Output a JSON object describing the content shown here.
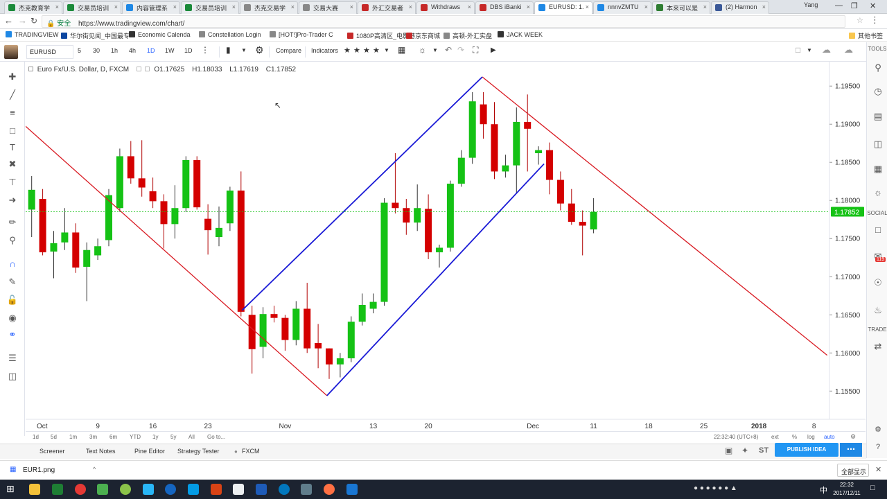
{
  "browser": {
    "tabs": [
      {
        "label": "杰克教育学",
        "color": "#1b8a3a",
        "active": false
      },
      {
        "label": "交易员培训",
        "color": "#1b8a3a",
        "active": false
      },
      {
        "label": "内容管理系",
        "color": "#1e88e5",
        "active": false
      },
      {
        "label": "交易员培训",
        "color": "#1b8a3a",
        "active": false
      },
      {
        "label": "杰克交易学",
        "color": "#888888",
        "active": false
      },
      {
        "label": "交易大赛",
        "color": "#888888",
        "active": false
      },
      {
        "label": "外汇交易者",
        "color": "#c62828",
        "active": false
      },
      {
        "label": "Withdraws",
        "color": "#c62828",
        "active": false
      },
      {
        "label": "DBS iBanki",
        "color": "#c62828",
        "active": false
      },
      {
        "label": "EURUSD: 1.",
        "color": "#1e88e5",
        "active": true
      },
      {
        "label": "nnnvZMTU",
        "color": "#1e88e5",
        "active": false
      },
      {
        "label": "本来可以是",
        "color": "#2e7d32",
        "active": false
      },
      {
        "label": "(2) Harmon",
        "color": "#3b5998",
        "active": false
      }
    ],
    "user": "Yang",
    "secure_label": "安全",
    "url": "https://www.tradingview.com/chart/",
    "bookmarks": [
      {
        "label": "TRADINGVIEW",
        "color": "#1e88e5"
      },
      {
        "label": "华尔街见闻_中国最专",
        "color": "#0d47a1"
      },
      {
        "label": "Economic Calenda",
        "color": "#333333"
      },
      {
        "label": "Constellation Login",
        "color": "#888888"
      },
      {
        "label": "[HOT!]Pro-Trader C",
        "color": "#888888"
      },
      {
        "label": "1080P高清区_电影港",
        "color": "#c62828"
      },
      {
        "label": "京东商城",
        "color": "#c62828"
      },
      {
        "label": "高顿-外汇实盘",
        "color": "#888888"
      },
      {
        "label": "JACK WEEK",
        "color": "#333333"
      }
    ],
    "other_bookmarks": "其他书签"
  },
  "toolbar": {
    "symbol": "EURUSD",
    "intervals": [
      "5",
      "30",
      "1h",
      "4h",
      "1D",
      "1W",
      "1D"
    ],
    "compare": "Compare",
    "indicators": "Indicators"
  },
  "legend": {
    "title": "Euro Fx/U.S. Dollar, D, FXCM",
    "open": "O1.17625",
    "high": "H1.18033",
    "low": "L1.17619",
    "close": "C1.17852"
  },
  "right_panel": {
    "tools_label": "TOOLS",
    "social_label": "SOCIAL",
    "trade_label": "TRADE",
    "badge": "119"
  },
  "range_bar": {
    "ranges": [
      "1d",
      "5d",
      "1m",
      "3m",
      "6m",
      "YTD",
      "1y",
      "5y",
      "All",
      "Go to..."
    ],
    "time": "22:32:40 (UTC+8)",
    "options": [
      "ext",
      "%",
      "log",
      "auto"
    ]
  },
  "bottom_panel": {
    "tabs": [
      "Screener",
      "Text Notes",
      "Pine Editor",
      "Strategy Tester",
      "FXCM"
    ],
    "publish": "PUBLISH IDEA"
  },
  "downloads": {
    "file": "EUR1.png",
    "show_all": "全部显示"
  },
  "taskbar": {
    "lang": "中",
    "time": "22:32",
    "date": "2017/12/11"
  },
  "chart_data": {
    "type": "candlestick",
    "price_scale": {
      "ticks": [
        "1.19500",
        "1.19000",
        "1.18500",
        "1.18000",
        "1.17500",
        "1.17000",
        "1.16500",
        "1.16000",
        "1.15500"
      ],
      "current": "1.17852",
      "ylim": [
        1.1513,
        1.1982
      ]
    },
    "time_ticks": [
      "Oct",
      "9",
      "16",
      "23",
      "Nov",
      "13",
      "20",
      "Dec",
      "11",
      "18",
      "25",
      "2018",
      "8"
    ],
    "colors": {
      "up": "#15c215",
      "down": "#d40000",
      "down_wick": "#b00000",
      "up_wick": "#333333",
      "trend_red": "#d91c24",
      "trend_blue": "#1a1ad6"
    },
    "candles": [
      {
        "o": 1.1788,
        "h": 1.1832,
        "l": 1.1752,
        "c": 1.1814
      },
      {
        "o": 1.1802,
        "h": 1.1815,
        "l": 1.1728,
        "c": 1.1732
      },
      {
        "o": 1.1733,
        "h": 1.176,
        "l": 1.1698,
        "c": 1.1744
      },
      {
        "o": 1.1745,
        "h": 1.179,
        "l": 1.1735,
        "c": 1.1758
      },
      {
        "o": 1.1758,
        "h": 1.177,
        "l": 1.1705,
        "c": 1.1712
      },
      {
        "o": 1.1713,
        "h": 1.1745,
        "l": 1.1668,
        "c": 1.1735
      },
      {
        "o": 1.1728,
        "h": 1.175,
        "l": 1.1722,
        "c": 1.174
      },
      {
        "o": 1.1748,
        "h": 1.1815,
        "l": 1.174,
        "c": 1.1807
      },
      {
        "o": 1.179,
        "h": 1.1868,
        "l": 1.1785,
        "c": 1.1858
      },
      {
        "o": 1.1858,
        "h": 1.1878,
        "l": 1.1822,
        "c": 1.1829
      },
      {
        "o": 1.1829,
        "h": 1.1879,
        "l": 1.1805,
        "c": 1.1817
      },
      {
        "o": 1.1812,
        "h": 1.183,
        "l": 1.179,
        "c": 1.1799
      },
      {
        "o": 1.1799,
        "h": 1.1808,
        "l": 1.1737,
        "c": 1.1769
      },
      {
        "o": 1.1769,
        "h": 1.182,
        "l": 1.175,
        "c": 1.179
      },
      {
        "o": 1.179,
        "h": 1.1858,
        "l": 1.1785,
        "c": 1.1853
      },
      {
        "o": 1.1853,
        "h": 1.1858,
        "l": 1.1788,
        "c": 1.1791
      },
      {
        "o": 1.1776,
        "h": 1.1795,
        "l": 1.1729,
        "c": 1.1761
      },
      {
        "o": 1.1752,
        "h": 1.1792,
        "l": 1.174,
        "c": 1.1764
      },
      {
        "o": 1.177,
        "h": 1.1818,
        "l": 1.176,
        "c": 1.1813
      },
      {
        "o": 1.1813,
        "h": 1.1838,
        "l": 1.1648,
        "c": 1.1654
      },
      {
        "o": 1.165,
        "h": 1.1662,
        "l": 1.1573,
        "c": 1.1605
      },
      {
        "o": 1.1608,
        "h": 1.166,
        "l": 1.1593,
        "c": 1.1651
      },
      {
        "o": 1.1651,
        "h": 1.1662,
        "l": 1.164,
        "c": 1.1646
      },
      {
        "o": 1.1646,
        "h": 1.165,
        "l": 1.1603,
        "c": 1.1617
      },
      {
        "o": 1.1617,
        "h": 1.1668,
        "l": 1.161,
        "c": 1.1658
      },
      {
        "o": 1.1658,
        "h": 1.1692,
        "l": 1.16,
        "c": 1.1606
      },
      {
        "o": 1.1613,
        "h": 1.1638,
        "l": 1.158,
        "c": 1.1606
      },
      {
        "o": 1.1606,
        "h": 1.1592,
        "l": 1.1566,
        "c": 1.1585
      },
      {
        "o": 1.1585,
        "h": 1.16,
        "l": 1.1568,
        "c": 1.1593
      },
      {
        "o": 1.1593,
        "h": 1.1648,
        "l": 1.1588,
        "c": 1.1641
      },
      {
        "o": 1.1641,
        "h": 1.1678,
        "l": 1.1636,
        "c": 1.1663
      },
      {
        "o": 1.1658,
        "h": 1.1678,
        "l": 1.1652,
        "c": 1.1667
      },
      {
        "o": 1.1667,
        "h": 1.1803,
        "l": 1.1662,
        "c": 1.1797
      },
      {
        "o": 1.1797,
        "h": 1.1862,
        "l": 1.1783,
        "c": 1.179
      },
      {
        "o": 1.179,
        "h": 1.1802,
        "l": 1.1755,
        "c": 1.1771
      },
      {
        "o": 1.1771,
        "h": 1.1821,
        "l": 1.176,
        "c": 1.179
      },
      {
        "o": 1.1789,
        "h": 1.1808,
        "l": 1.1723,
        "c": 1.1732
      },
      {
        "o": 1.1732,
        "h": 1.1742,
        "l": 1.1712,
        "c": 1.1738
      },
      {
        "o": 1.1738,
        "h": 1.1826,
        "l": 1.1733,
        "c": 1.1822
      },
      {
        "o": 1.1822,
        "h": 1.1866,
        "l": 1.1818,
        "c": 1.1856
      },
      {
        "o": 1.1856,
        "h": 1.1942,
        "l": 1.1848,
        "c": 1.193
      },
      {
        "o": 1.1926,
        "h": 1.1942,
        "l": 1.1881,
        "c": 1.19
      },
      {
        "o": 1.19,
        "h": 1.1929,
        "l": 1.1828,
        "c": 1.1838
      },
      {
        "o": 1.1838,
        "h": 1.186,
        "l": 1.183,
        "c": 1.1846
      },
      {
        "o": 1.1846,
        "h": 1.1922,
        "l": 1.181,
        "c": 1.1903
      },
      {
        "o": 1.1903,
        "h": 1.1939,
        "l": 1.1838,
        "c": 1.1894
      },
      {
        "o": 1.1862,
        "h": 1.1871,
        "l": 1.1847,
        "c": 1.1866
      },
      {
        "o": 1.1866,
        "h": 1.1876,
        "l": 1.1808,
        "c": 1.1827
      },
      {
        "o": 1.1827,
        "h": 1.1838,
        "l": 1.1787,
        "c": 1.1796
      },
      {
        "o": 1.1796,
        "h": 1.1815,
        "l": 1.1768,
        "c": 1.1772
      },
      {
        "o": 1.1772,
        "h": 1.1787,
        "l": 1.1728,
        "c": 1.1767
      },
      {
        "o": 1.1762,
        "h": 1.1803,
        "l": 1.1757,
        "c": 1.1785
      }
    ],
    "trend_lines": [
      {
        "color": "red",
        "points": [
          [
            -1.3,
            1.1907
          ],
          [
            26.8,
            1.1544
          ]
        ]
      },
      {
        "color": "red",
        "points": [
          [
            40.9,
            1.1962
          ],
          [
            72.2,
            1.1597
          ]
        ]
      },
      {
        "color": "blue",
        "points": [
          [
            19.1,
            1.1656
          ],
          [
            40.9,
            1.1962
          ]
        ]
      },
      {
        "color": "blue",
        "points": [
          [
            26.8,
            1.1544
          ],
          [
            46.5,
            1.1848
          ]
        ]
      }
    ]
  }
}
